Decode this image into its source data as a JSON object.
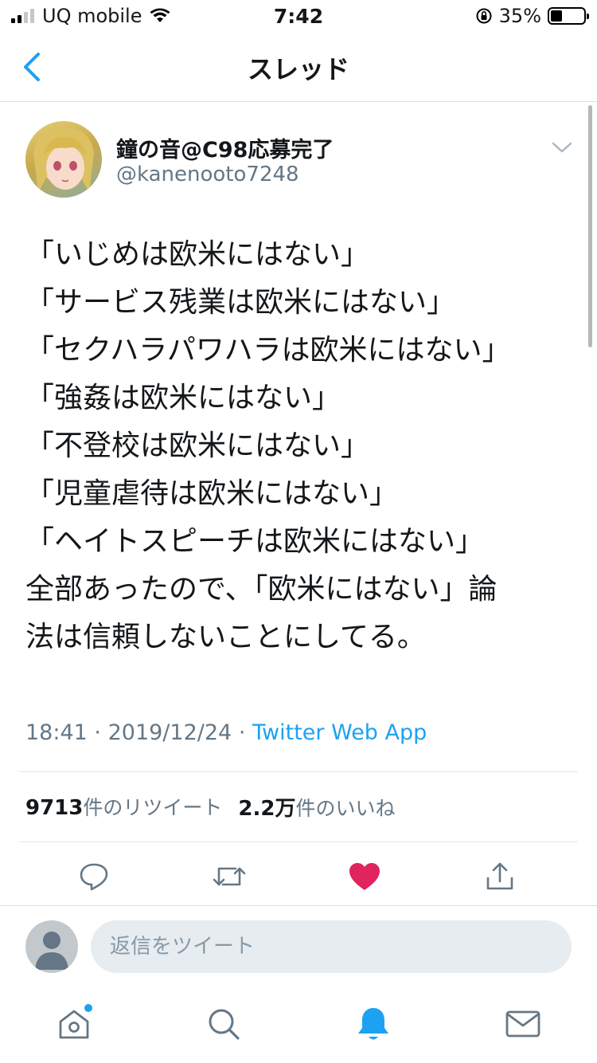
{
  "status_bar": {
    "carrier": "UQ mobile",
    "time": "7:42",
    "battery_percent": "35%",
    "battery_level": 0.35
  },
  "nav": {
    "title": "スレッド"
  },
  "tweet": {
    "display_name": "鐘の音@C98応募完了",
    "handle": "@kanenooto7248",
    "lines": [
      "「いじめは欧米にはない」",
      "「サービス残業は欧米にはない」",
      "「セクハラパワハラは欧米にはない」",
      "「強姦は欧米にはない」",
      "「不登校は欧米にはない」",
      "「児童虐待は欧米にはない」",
      "「ヘイトスピーチは欧米にはない」",
      "全部あったので、「欧米にはない」論",
      "法は信頼しないことにしてる。"
    ],
    "time": "18:41",
    "date": "2019/12/24",
    "separator": "·",
    "source": "Twitter Web App",
    "retweet_count": "9713",
    "retweet_label": "件のリツイート",
    "like_count": "2.2万",
    "like_label": "件のいいね"
  },
  "reply": {
    "placeholder": "返信をツイート"
  },
  "colors": {
    "accent": "#1da1f2",
    "like": "#e0245e",
    "secondary_text": "#657786",
    "icon_gray": "#657786"
  },
  "icons": [
    "back-chevron-icon",
    "caret-down-icon",
    "reply-icon",
    "retweet-icon",
    "like-heart-icon",
    "share-icon",
    "home-icon",
    "search-icon",
    "notifications-bell-icon",
    "messages-envelope-icon"
  ]
}
